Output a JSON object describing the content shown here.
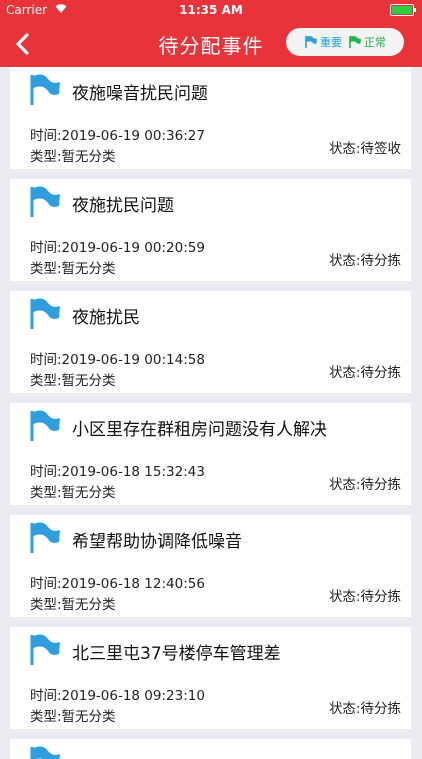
{
  "status_bar": {
    "carrier": "Carrier",
    "time": "11:35 AM",
    "battery_level": 1.0
  },
  "nav": {
    "title": "待分配事件",
    "legend": {
      "important_label": "重要",
      "normal_label": "正常"
    }
  },
  "colors": {
    "brand": "#e8333a",
    "flag_important": "#2e9fdc",
    "flag_normal": "#1fb34a"
  },
  "events": [
    {
      "title": "夜施噪音扰民问题",
      "time": "时间:2019-06-19 00:36:27",
      "type": "类型:暂无分类",
      "status": "状态:待签收"
    },
    {
      "title": "夜施扰民问题",
      "time": "时间:2019-06-19 00:20:59",
      "type": "类型:暂无分类",
      "status": "状态:待分拣"
    },
    {
      "title": "夜施扰民",
      "time": "时间:2019-06-19 00:14:58",
      "type": "类型:暂无分类",
      "status": "状态:待分拣"
    },
    {
      "title": "小区里存在群租房问题没有人解决",
      "time": "时间:2019-06-18 15:32:43",
      "type": "类型:暂无分类",
      "status": "状态:待分拣"
    },
    {
      "title": "希望帮助协调降低噪音",
      "time": "时间:2019-06-18 12:40:56",
      "type": "类型:暂无分类",
      "status": "状态:待分拣"
    },
    {
      "title": "北三里屯37号楼停车管理差",
      "time": "时间:2019-06-18 09:23:10",
      "type": "类型:暂无分类",
      "status": "状态:待分拣"
    }
  ]
}
